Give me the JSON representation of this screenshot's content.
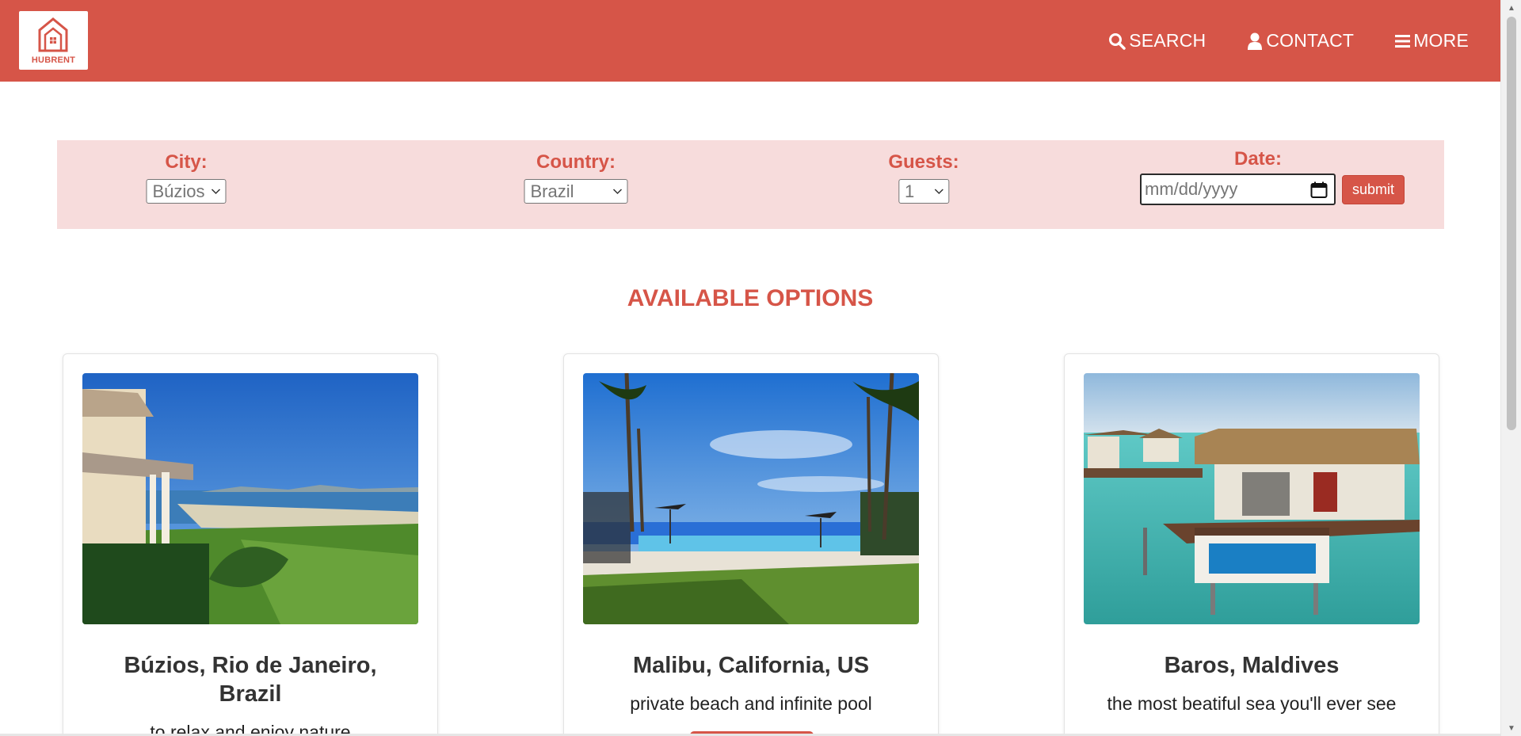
{
  "brand": {
    "name": "HUBRENT"
  },
  "nav": [
    {
      "label": "SEARCH",
      "icon": "search-icon"
    },
    {
      "label": "CONTACT",
      "icon": "user-icon"
    },
    {
      "label": "MORE",
      "icon": "menu-icon"
    }
  ],
  "search": {
    "city_label": "City:",
    "city_value": "Búzios",
    "country_label": "Country:",
    "country_value": "Brazil",
    "guests_label": "Guests:",
    "guests_value": "1",
    "date_label": "Date:",
    "date_placeholder": "mm/dd/yyyy",
    "submit_label": "submit"
  },
  "section_title": "AVAILABLE OPTIONS",
  "cards": [
    {
      "title": "Búzios, Rio de Janeiro, Brazil",
      "desc": "to relax and enjoy nature"
    },
    {
      "title": "Malibu, California, US",
      "desc": "private beach and infinite pool"
    },
    {
      "title": "Baros, Maldives",
      "desc": "the most beatiful sea you'll ever see"
    }
  ],
  "colors": {
    "brand": "#d65548",
    "searchbar_bg": "#f7dcdc"
  }
}
